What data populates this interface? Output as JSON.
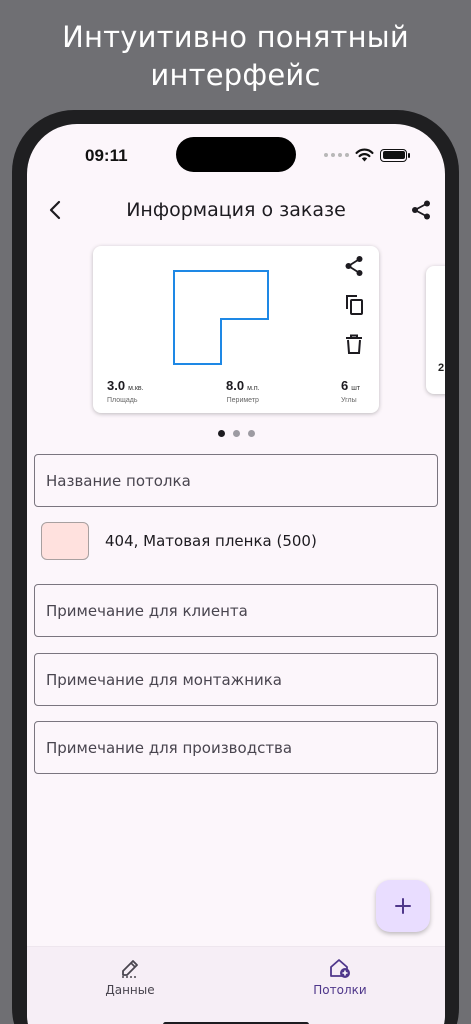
{
  "promo": {
    "line1": "Интуитивно понятный",
    "line2": "интерфейс"
  },
  "status_bar": {
    "time": "09:11"
  },
  "app_bar": {
    "title": "Информация о заказе",
    "icons": {
      "back": "back-arrow-icon",
      "share": "share-icon"
    }
  },
  "ceiling_card": {
    "stats": [
      {
        "value": "3.0",
        "unit": "м.кв.",
        "label": "Площадь"
      },
      {
        "value": "8.0",
        "unit": "м.п.",
        "label": "Периметр"
      },
      {
        "value": "6",
        "unit": "шт",
        "label": "Углы"
      }
    ],
    "actions": [
      "share-icon",
      "copy-icon",
      "delete-icon"
    ],
    "peek_text": "2"
  },
  "pagination": {
    "count": 3,
    "active": 0
  },
  "form": {
    "ceiling_name_placeholder": "Название потолка",
    "film": {
      "label": "404, Матовая пленка (500)",
      "swatch_color": "#ffe1de"
    },
    "note_client_placeholder": "Примечание для клиента",
    "note_installer_placeholder": "Примечание для монтажника",
    "note_production_placeholder": "Примечание для производства"
  },
  "fab": {
    "icon": "plus-icon",
    "color": "#e9ddff"
  },
  "bottom_nav": {
    "items": [
      {
        "label": "Данные",
        "icon": "pencil-ruler-icon",
        "selected": false
      },
      {
        "label": "Потолки",
        "icon": "house-add-icon",
        "selected": true
      }
    ]
  },
  "colors": {
    "accent": "#4f378b",
    "drawing_stroke": "#1e88e5",
    "background": "#fcf6fb"
  }
}
